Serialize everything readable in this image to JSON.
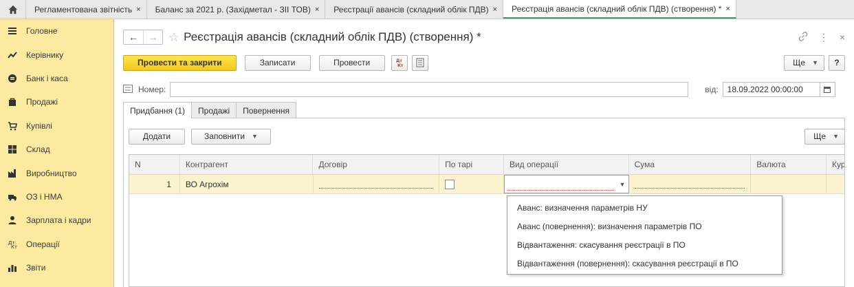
{
  "top_tabs": [
    {
      "label": "Регламентована звітність",
      "close": "×"
    },
    {
      "label": "Баланс за 2021 р. (Західметал - ЗІІ ТОВ)",
      "close": "×"
    },
    {
      "label": "Реєстрації авансів (складний облік ПДВ)",
      "close": "×"
    },
    {
      "label": "Реєстрація авансів (складний облік ПДВ) (створення) *",
      "close": "×"
    }
  ],
  "sidebar": {
    "items": [
      {
        "label": "Головне",
        "icon": "menu-icon"
      },
      {
        "label": "Керівнику",
        "icon": "chart-trend-icon"
      },
      {
        "label": "Банк і каса",
        "icon": "coin-icon"
      },
      {
        "label": "Продажі",
        "icon": "bag-icon"
      },
      {
        "label": "Купівлі",
        "icon": "cart-icon"
      },
      {
        "label": "Склад",
        "icon": "warehouse-icon"
      },
      {
        "label": "Виробництво",
        "icon": "factory-icon"
      },
      {
        "label": "ОЗ і НМА",
        "icon": "truck-icon"
      },
      {
        "label": "Зарплата і кадри",
        "icon": "person-icon"
      },
      {
        "label": "Операції",
        "icon": "dt-kt-icon"
      },
      {
        "label": "Звіти",
        "icon": "bar-chart-icon"
      }
    ],
    "bg_color": "#fbeaa0"
  },
  "form": {
    "title": "Реєстрація авансів (складний облік ПДВ) (створення) *",
    "nav_back": "←",
    "nav_forward": "→",
    "star": "☆",
    "link_icon": "🔗",
    "more_icon": "⋮",
    "close_icon": "×",
    "toolbar": {
      "post_close": "Провести та закрити",
      "save": "Записати",
      "post": "Провести",
      "dtkt": "Дт Кт",
      "more": "Ще",
      "help": "?"
    },
    "number_label": "Номер:",
    "number_value": "",
    "date_label": "від:",
    "date_value": "18.09.2022 00:00:00",
    "tabs": [
      "Придбання (1)",
      "Продажі",
      "Повернення"
    ],
    "table_toolbar": {
      "add": "Додати",
      "fill": "Заповнити",
      "more": "Ще"
    },
    "table": {
      "columns": [
        "N",
        "Контрагент",
        "Договір",
        "По тарі",
        "Вид операції",
        "Сума",
        "Валюта",
        "Кур"
      ],
      "rows": [
        {
          "n": "1",
          "counterparty": "ВО Агрохім",
          "contract": "",
          "tare": false,
          "operation": "",
          "sum": "",
          "currency": ""
        }
      ]
    },
    "operation_dropdown": [
      "Аванс: визначення параметрів НУ",
      "Аванс (повернення): визначення параметрів ПО",
      "Відвантаження: скасування реєстрації в ПО",
      "Відвантаження (повернення): скасування реєстрації в ПО"
    ],
    "accent_color": "#f3c81c"
  }
}
